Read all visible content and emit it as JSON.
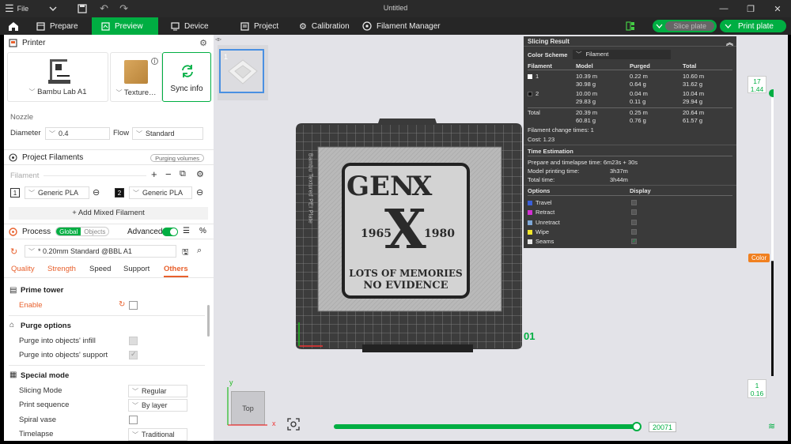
{
  "window": {
    "title": "Untitled",
    "file_menu": "File"
  },
  "nav": {
    "tabs": [
      {
        "label": "Prepare"
      },
      {
        "label": "Preview"
      },
      {
        "label": "Device"
      },
      {
        "label": "Project"
      },
      {
        "label": "Calibration"
      },
      {
        "label": "Filament Manager"
      }
    ],
    "slice_label": "Slice plate",
    "print_label": "Print plate"
  },
  "printer": {
    "section_title": "Printer",
    "printer_name": "Bambu Lab A1",
    "plate_name": "Texture…",
    "sync_label": "Sync info",
    "nozzle_label": "Nozzle",
    "diameter_label": "Diameter",
    "diameter_value": "0.4",
    "flow_label": "Flow",
    "flow_value": "Standard"
  },
  "filaments": {
    "section_title": "Project Filaments",
    "purging_label": "Purging volumes",
    "filament_label": "Filament",
    "items": [
      {
        "num": "1",
        "name": "Generic PLA",
        "color": "#ffffff"
      },
      {
        "num": "2",
        "name": "Generic PLA",
        "color": "#111111"
      }
    ],
    "add_mixed_label": "+ Add Mixed Filament"
  },
  "process": {
    "section_title": "Process",
    "global_label": "Global",
    "objects_label": "Objects",
    "advanced_label": "Advanced",
    "preset": "* 0.20mm Standard @BBL A1",
    "tabs": [
      "Quality",
      "Strength",
      "Speed",
      "Support",
      "Others"
    ],
    "active_tab": "Others",
    "prime_tower_title": "Prime tower",
    "enable_label": "Enable",
    "purge_title": "Purge options",
    "purge_infill_label": "Purge into objects' infill",
    "purge_support_label": "Purge into objects' support",
    "special_title": "Special mode",
    "slicing_mode_label": "Slicing Mode",
    "slicing_mode_value": "Regular",
    "print_sequence_label": "Print sequence",
    "print_sequence_value": "By layer",
    "spiral_label": "Spiral vase",
    "timelapse_label": "Timelapse",
    "timelapse_value": "Traditional"
  },
  "viewport": {
    "thumb_number": "1",
    "plate_number": "01",
    "plate_brand": "Bambu Textured PEI Plate",
    "design_lines": [
      "GEN",
      "X",
      "1965",
      "1980",
      "LOTS OF MEMORIES",
      "NO EVIDENCE"
    ],
    "view_cube_label": "Top",
    "axis_x": "x",
    "axis_y": "y",
    "move_value": "20071",
    "move_progress": 1.0,
    "layer_top": "17",
    "layer_top_height": "1.44",
    "layer_bottom": "1",
    "layer_bottom_height": "0.16",
    "color_tag": "Color",
    "layer_slider_top_fraction": 1.0,
    "layer_slider_bottom_fraction": 0.0
  },
  "slicing_result": {
    "title": "Slicing Result",
    "color_scheme_label": "Color Scheme",
    "color_scheme_value": "Filament",
    "headers": [
      "Filament",
      "Model",
      "Purged",
      "Total"
    ],
    "rows": [
      {
        "name": "1",
        "color": "#ffffff",
        "model": [
          "10.39 m",
          "30.98 g"
        ],
        "purged": [
          "0.22 m",
          "0.64 g"
        ],
        "total": [
          "10.60 m",
          "31.62 g"
        ]
      },
      {
        "name": "2",
        "color": "#111111",
        "model": [
          "10.00 m",
          "29.83 g"
        ],
        "purged": [
          "0.04 m",
          "0.11 g"
        ],
        "total": [
          "10.04 m",
          "29.94 g"
        ]
      }
    ],
    "total_row": {
      "name": "Total",
      "model": [
        "20.39 m",
        "60.81 g"
      ],
      "purged": [
        "0.25 m",
        "0.76 g"
      ],
      "total": [
        "20.64 m",
        "61.57 g"
      ]
    },
    "change_times": "Filament change times:  1",
    "cost": "Cost:  1.23",
    "time_title": "Time Estimation",
    "prepare_time": "Prepare and timelapse time: 6m23s + 30s",
    "model_time_label": "Model printing time:",
    "model_time": "3h37m",
    "total_time_label": "Total time:",
    "total_time": "3h44m",
    "options_label": "Options",
    "display_label": "Display",
    "options": [
      {
        "name": "Travel",
        "color": "#3a5fd9",
        "checked": false
      },
      {
        "name": "Retract",
        "color": "#d42fd4",
        "checked": false
      },
      {
        "name": "Unretract",
        "color": "#7fa8d8",
        "checked": false
      },
      {
        "name": "Wipe",
        "color": "#f2e62a",
        "checked": false
      },
      {
        "name": "Seams",
        "color": "#e8e8e8",
        "checked": true
      }
    ]
  },
  "colors": {
    "accent": "#00ae42",
    "orange": "#e8602c"
  }
}
